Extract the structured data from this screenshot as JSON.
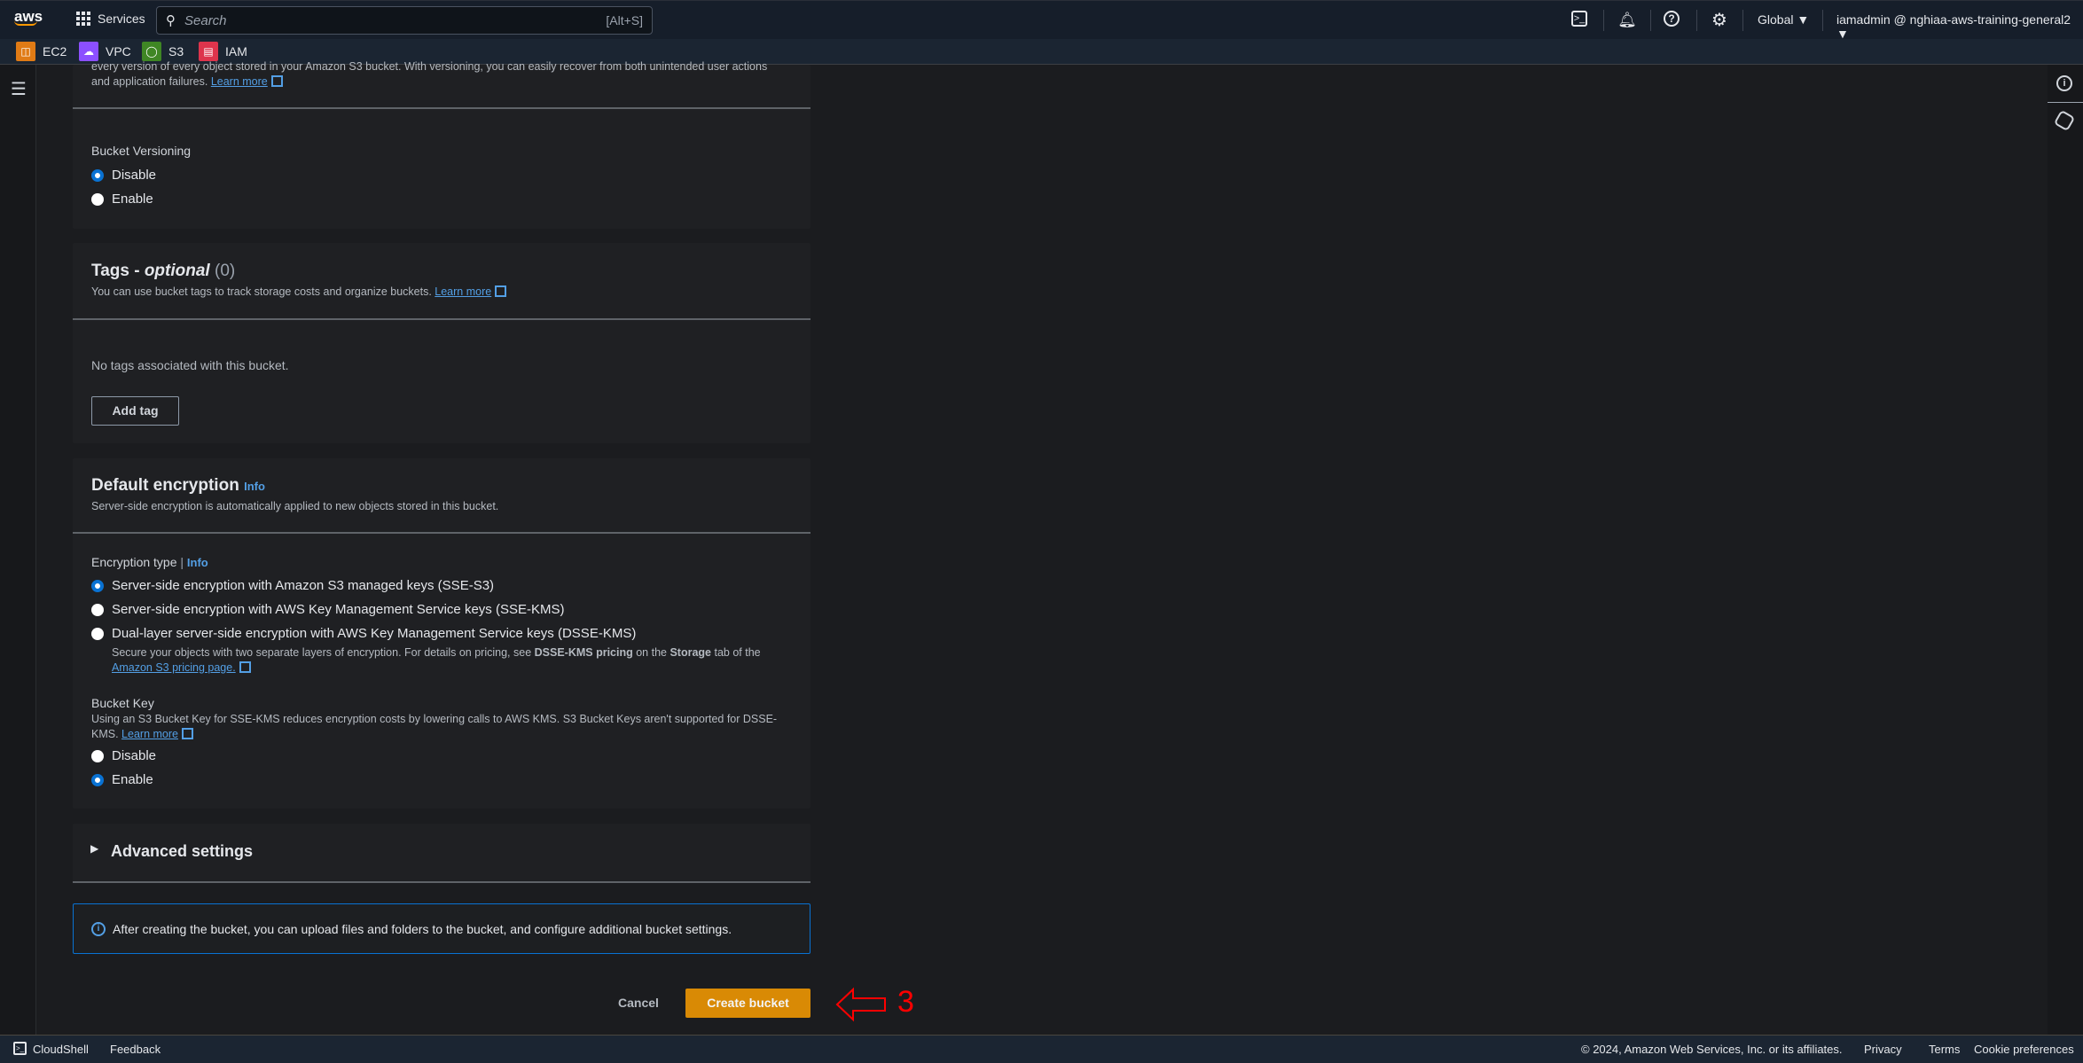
{
  "header": {
    "logo": "aws",
    "services_label": "Services",
    "search_placeholder": "Search",
    "search_shortcut": "[Alt+S]",
    "region": "Global ▼",
    "account": "iamadmin @ nghiaa-aws-training-general2 ▼",
    "icons": [
      "cloudshell-icon",
      "bell-icon",
      "help-icon",
      "settings-icon"
    ]
  },
  "favorites": [
    {
      "label": "EC2",
      "color": "#e07b15"
    },
    {
      "label": "VPC",
      "color": "#8c4fff"
    },
    {
      "label": "S3",
      "color": "#3f8624"
    },
    {
      "label": "IAM",
      "color": "#dd344c"
    }
  ],
  "versioning": {
    "desc_line1": "every version of every object stored in your Amazon S3 bucket. With versioning, you can easily recover from both unintended user actions",
    "desc_line2": "and application failures.",
    "learn_more": "Learn more",
    "label": "Bucket Versioning",
    "options": [
      "Disable",
      "Enable"
    ],
    "selected": "Disable"
  },
  "tags": {
    "title": "Tags - ",
    "optional": "optional",
    "count": "(0)",
    "desc": "You can use bucket tags to track storage costs and organize buckets.",
    "learn_more": "Learn more",
    "empty": "No tags associated with this bucket.",
    "add_tag": "Add tag"
  },
  "encryption": {
    "title": "Default encryption",
    "info": "Info",
    "desc": "Server-side encryption is automatically applied to new objects stored in this bucket.",
    "type_label": "Encryption type",
    "type_info": "Info",
    "options": [
      "Server-side encryption with Amazon S3 managed keys (SSE-S3)",
      "Server-side encryption with AWS Key Management Service keys (SSE-KMS)",
      "Dual-layer server-side encryption with AWS Key Management Service keys (DSSE-KMS)"
    ],
    "selected": "Server-side encryption with Amazon S3 managed keys (SSE-S3)",
    "dsse_desc_a": "Secure your objects with two separate layers of encryption. For details on pricing, see ",
    "dsse_desc_b": "DSSE-KMS pricing",
    "dsse_desc_c": " on the ",
    "dsse_desc_d": "Storage",
    "dsse_desc_e": " tab of the",
    "dsse_link": "Amazon S3 pricing page.",
    "bucket_key_label": "Bucket Key",
    "bucket_key_desc1": "Using an S3 Bucket Key for SSE-KMS reduces encryption costs by lowering calls to AWS KMS. S3 Bucket Keys aren't supported for DSSE-",
    "bucket_key_desc2": "KMS.",
    "bucket_key_learn": "Learn more",
    "bucket_key_options": [
      "Disable",
      "Enable"
    ],
    "bucket_key_selected": "Enable"
  },
  "advanced": {
    "label": "Advanced settings"
  },
  "alert": {
    "text": "After creating the bucket, you can upload files and folders to the bucket, and configure additional bucket settings."
  },
  "actions": {
    "cancel": "Cancel",
    "create": "Create bucket"
  },
  "annotation": {
    "step": "3",
    "color": "#ff0000"
  },
  "footer": {
    "cloudshell": "CloudShell",
    "feedback": "Feedback",
    "copyright": "© 2024, Amazon Web Services, Inc. or its affiliates.",
    "privacy": "Privacy",
    "terms": "Terms",
    "cookies": "Cookie preferences"
  }
}
